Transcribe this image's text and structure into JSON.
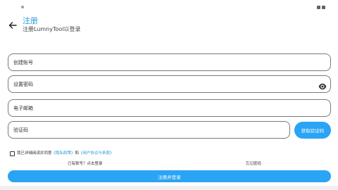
{
  "header": {
    "title": "注册",
    "subtitle": "注册LumnyTool以登录"
  },
  "form": {
    "account_placeholder": "创建账号",
    "password_placeholder": "设置密码",
    "email_placeholder": "电子邮箱",
    "code_placeholder": "验证码",
    "get_code_label": "获取验证码"
  },
  "agreement": {
    "prefix": "我已详细阅读并同意",
    "privacy_link": "《隐私政策》",
    "and": "和",
    "terms_link": "《用户协议与条款》",
    "checked": false
  },
  "links": {
    "has_account": "已有账号？点击登录",
    "forgot_password": "忘记密码"
  },
  "submit_label": "注册并登录",
  "colors": {
    "accent": "#2aa4f4",
    "link": "#2a9bd8"
  },
  "icons": {
    "back": "arrow-left-icon",
    "password_visibility": "eye-icon"
  }
}
